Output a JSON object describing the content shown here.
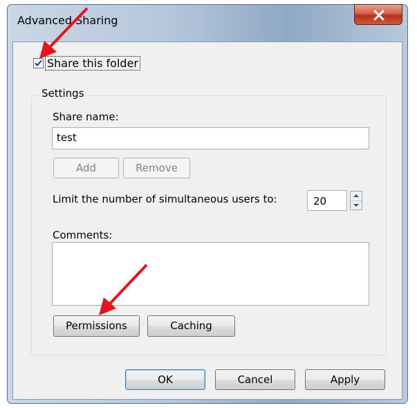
{
  "dialog": {
    "title": "Advanced Sharing",
    "share_checkbox": {
      "label": "Share this folder",
      "checked": true
    },
    "settings": {
      "group_label": "Settings",
      "share_name_label": "Share name:",
      "share_name_value": "test",
      "add_label": "Add",
      "remove_label": "Remove",
      "limit_label": "Limit the number of simultaneous users to:",
      "limit_value": "20",
      "comments_label": "Comments:",
      "comments_value": "",
      "permissions_label": "Permissions",
      "caching_label": "Caching"
    },
    "footer": {
      "ok_label": "OK",
      "cancel_label": "Cancel",
      "apply_label": "Apply"
    }
  },
  "annotations": {
    "arrow_color": "#e8131b"
  }
}
